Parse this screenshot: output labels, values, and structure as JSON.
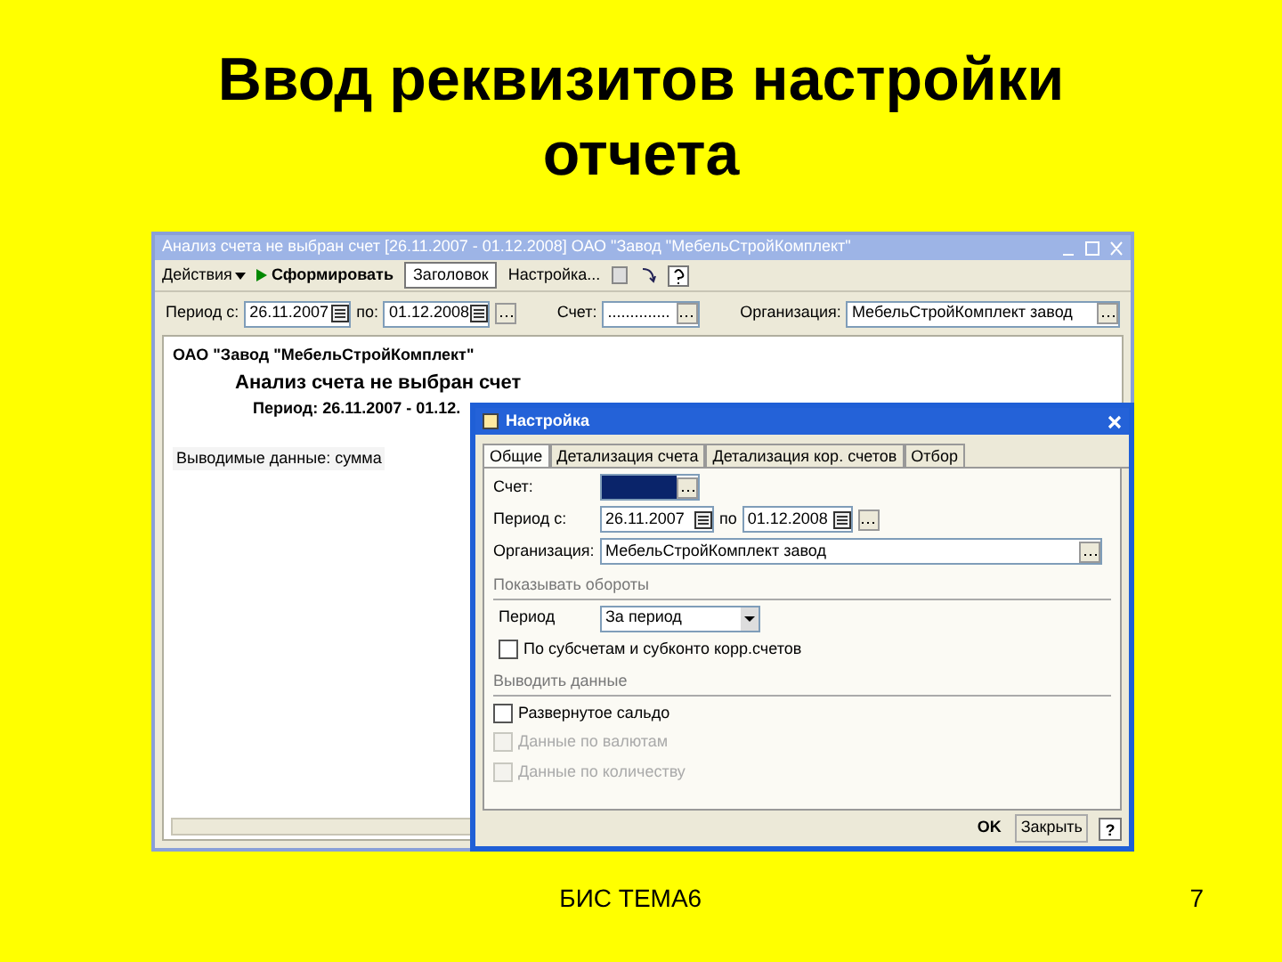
{
  "slide": {
    "title": "Ввод реквизитов настройки отчета",
    "footer": "БИС ТЕМА6",
    "page_number": "7"
  },
  "main_window": {
    "title": "Анализ счета  не выбран счет [26.11.2007 - 01.12.2008] ОАО \"Завод \"МебельСтройКомплект\"",
    "toolbar": [
      {
        "kind": "menu",
        "label": "Действия"
      },
      {
        "kind": "run",
        "label": "Сформировать"
      },
      {
        "kind": "toggle",
        "label": "Заголовок",
        "selected": true
      },
      {
        "kind": "plain",
        "label": "Настройка..."
      }
    ],
    "filters": {
      "period_label": "Период с:",
      "date_from": "26.11.2007",
      "to_label": "по:",
      "date_to": "01.12.2008",
      "account_label": "Счет:",
      "account_value": "..............",
      "org_label": "Организация:",
      "org_value": "МебельСтройКомплект завод"
    },
    "report": {
      "company": "ОАО \"Завод \"МебельСтройКомплект\"",
      "heading": "Анализ счета  не выбран счет",
      "period": "Период: 26.11.2007 - 01.12.",
      "output_line": "Выводимые данные: сумма"
    }
  },
  "dialog": {
    "title": "Настройка",
    "tabs": [
      {
        "label": "Общие",
        "selected": true
      },
      {
        "label": "Детализация счета",
        "selected": false
      },
      {
        "label": "Детализация кор. счетов",
        "selected": false
      },
      {
        "label": "Отбор",
        "selected": false
      }
    ],
    "account_label": "Счет:",
    "period_label": "Период с:",
    "date_from": "26.11.2007",
    "to_label": "по",
    "date_to": "01.12.2008",
    "org_label": "Организация:",
    "org_value": "МебельСтройКомплект завод",
    "turnover_section": "Показывать обороты",
    "period_kind_label": "Период",
    "period_kind_value": "За период",
    "subaccount_checkbox": {
      "label": "По субсчетам и субконто корр.счетов",
      "checked": false,
      "disabled": false
    },
    "output_section": "Выводить данные",
    "checkboxes": [
      {
        "label": "Развернутое сальдо",
        "checked": false,
        "disabled": false
      },
      {
        "label": "Данные по валютам",
        "checked": false,
        "disabled": true
      },
      {
        "label": "Данные по количеству",
        "checked": false,
        "disabled": true
      }
    ],
    "buttons": [
      {
        "kind": "ok",
        "label": "OK"
      },
      {
        "kind": "close",
        "label": "Закрыть"
      },
      {
        "kind": "help",
        "label": "?"
      }
    ]
  }
}
